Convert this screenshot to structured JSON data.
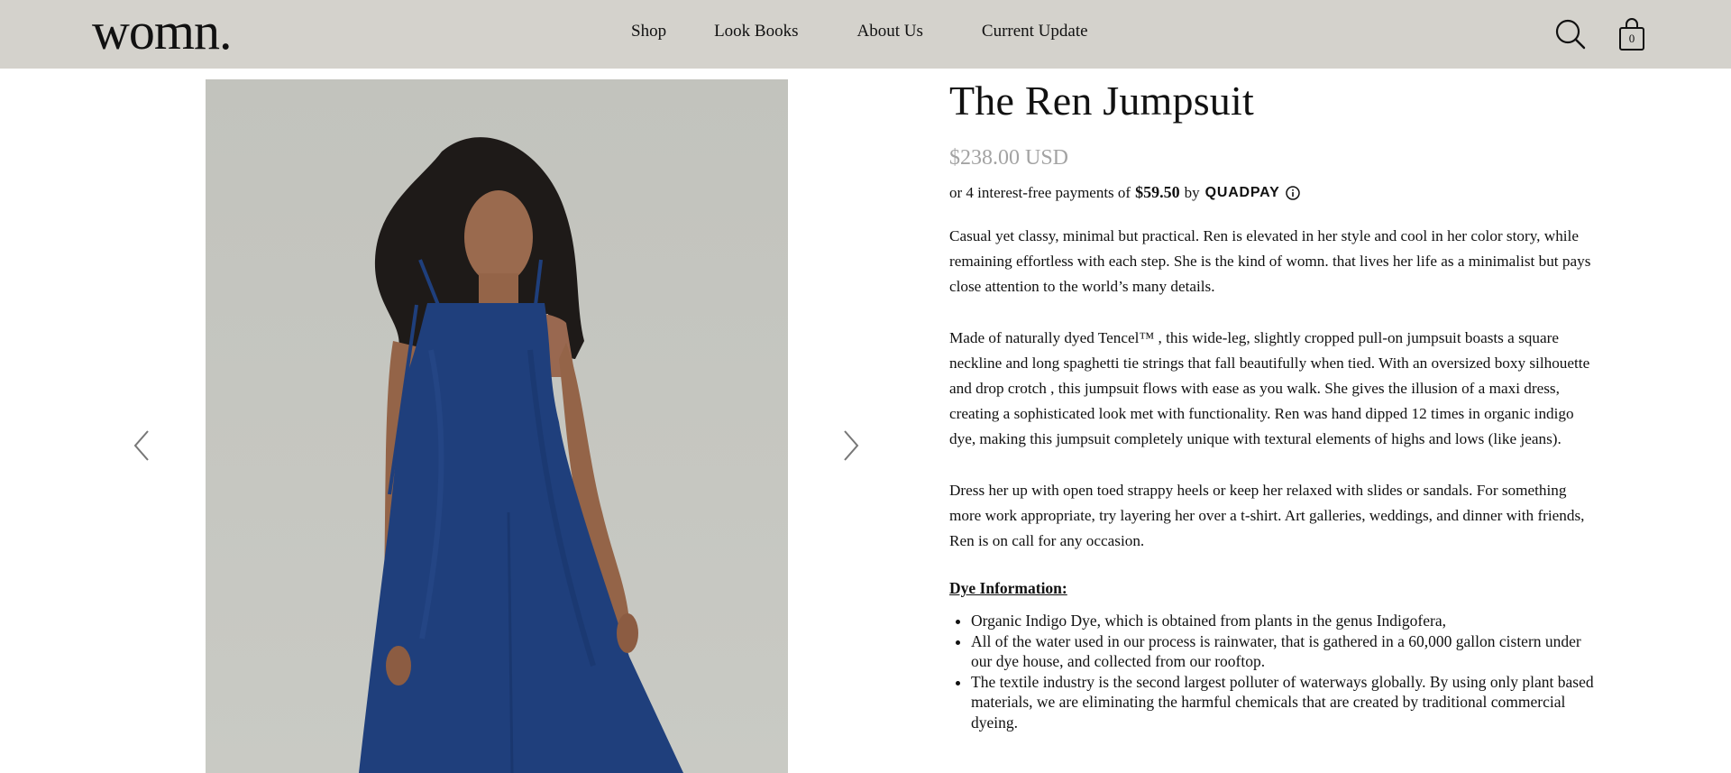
{
  "header": {
    "logo": "womn.",
    "nav": [
      "Shop",
      "Look Books",
      "About Us",
      "Current Update"
    ],
    "cart_count": "0"
  },
  "product": {
    "title": "The Ren Jumpsuit",
    "price": "$238.00 USD",
    "installments": {
      "prefix": "or 4 interest-free payments of",
      "amount": "$59.50",
      "by": "by",
      "provider": "QUADPAY"
    },
    "description": [
      "Casual yet classy, minimal but practical. Ren is elevated in her style and cool in her color story, while remaining effortless with each step. She is the kind of womn. that lives her life as a minimalist but pays close attention to the world’s many details.",
      "Made of naturally dyed Tencel™ , this wide-leg, slightly cropped pull-on jumpsuit boasts a square neckline and long spaghetti tie strings that fall beautifully when tied. With an oversized boxy silhouette and drop crotch , this jumpsuit flows with ease as you walk. She gives the illusion of a maxi dress, creating a sophisticated look met with functionality. Ren was hand dipped 12 times in organic indigo dye, making this jumpsuit completely unique with textural elements of highs and lows (like jeans).",
      "Dress her up with open toed strappy heels or keep her relaxed with slides or sandals. For something more work appropriate, try layering her over a t-shirt. Art galleries, weddings, and dinner with friends, Ren is on call for any occasion."
    ],
    "dye_heading": "Dye Information:",
    "dye_items": [
      "Organic Indigo Dye, which is obtained from plants in the genus Indigofera,",
      "All of the water used in our process is rainwater, that is gathered in a 60,000 gallon cistern under our dye house, and collected from our rooftop.",
      "The textile industry is the second largest polluter of waterways globally. By using only plant based materials, we are eliminating the harmful chemicals that are created by traditional commercial dyeing."
    ]
  },
  "colors": {
    "header_bg": "#d4d2cc",
    "price": "#a3a3a3",
    "jumpsuit_indigo": "#1f3f7c"
  },
  "icons": [
    "search-icon",
    "shopping-bag-icon",
    "chevron-left-icon",
    "chevron-right-icon",
    "info-icon"
  ]
}
